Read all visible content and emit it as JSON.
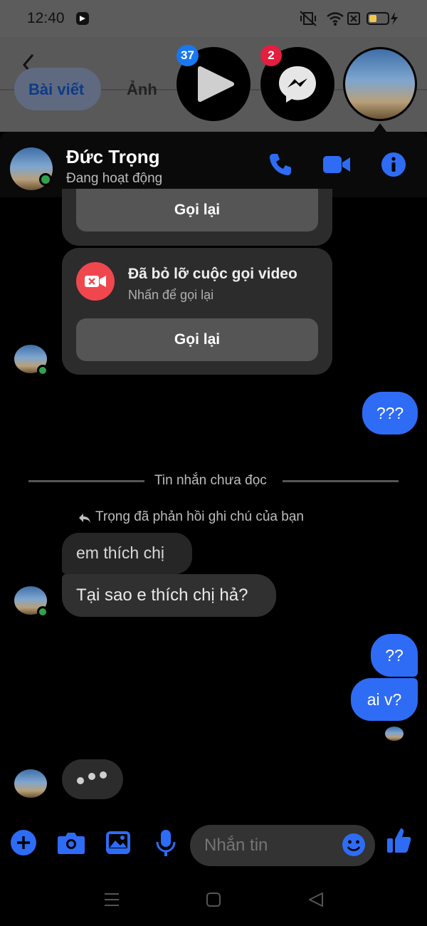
{
  "status_bar": {
    "time": "12:40"
  },
  "background_app": {
    "tab_posts": "Bài viết",
    "tab_photos": "Ảnh"
  },
  "chat_heads": {
    "video_badge": "37",
    "messenger_badge": "2"
  },
  "header": {
    "name": "Đức Trọng",
    "status": "Đang hoạt động"
  },
  "messages": {
    "call_back_1": "Gọi lại",
    "missed_video_title": "Đã bỏ lỡ cuộc gọi video",
    "missed_video_sub": "Nhấn để gọi lại",
    "call_back_2": "Gọi lại",
    "out_1": "???",
    "unread_divider": "Tin nhắn chưa đọc",
    "reply_note": "Trọng đã phản hồi ghi chú của bạn",
    "in_1": "em thích chị",
    "in_2": "Tại sao e thích chị hả?",
    "out_2": "??",
    "out_3": "ai v?"
  },
  "composer": {
    "placeholder": "Nhắn tin"
  },
  "colors": {
    "accent": "#2e6cf6",
    "missed_call": "#f0474e",
    "online": "#31a24c",
    "badge_blue": "#1877f2",
    "badge_red": "#e41e3f"
  }
}
